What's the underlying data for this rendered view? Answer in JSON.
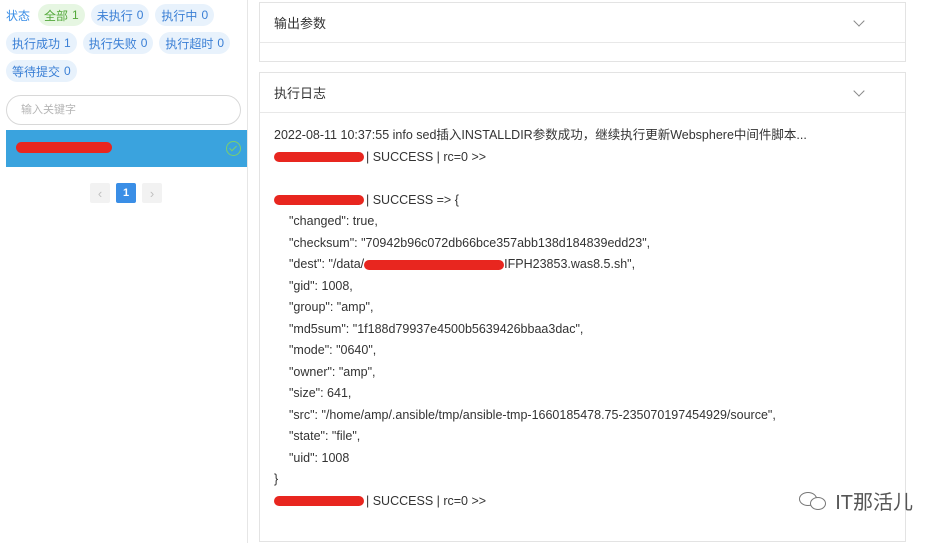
{
  "filters": {
    "status_label": "状态",
    "chips": [
      {
        "label": "全部",
        "count": "1",
        "active": true
      },
      {
        "label": "未执行",
        "count": "0"
      },
      {
        "label": "执行中",
        "count": "0"
      },
      {
        "label": "执行成功",
        "count": "1"
      },
      {
        "label": "执行失败",
        "count": "0"
      },
      {
        "label": "执行超时",
        "count": "0"
      },
      {
        "label": "等待提交",
        "count": "0"
      }
    ]
  },
  "search": {
    "placeholder": "输入关键字"
  },
  "pagination": {
    "prev": "‹",
    "current": "1",
    "next": "›"
  },
  "panels": {
    "output_params_title": "输出参数",
    "exec_log_title": "执行日志"
  },
  "log": {
    "line1": "2022-08-11 10:37:55 info sed插入INSTALLDIR参数成功，继续执行更新Websphere中间件脚本...",
    "line2_suffix": "| SUCCESS | rc=0 >>",
    "line4_suffix": "| SUCCESS => {",
    "changed": "\"changed\": true,",
    "checksum": "\"checksum\": \"70942b96c072db66bce357abb138d184839edd23\",",
    "dest_prefix": "\"dest\": \"/data/",
    "dest_suffix": "IFPH23853.was8.5.sh\",",
    "gid": "\"gid\": 1008,",
    "group": "\"group\": \"amp\",",
    "md5sum": "\"md5sum\": \"1f188d79937e4500b5639426bbaa3dac\",",
    "mode": "\"mode\": \"0640\",",
    "owner": "\"owner\": \"amp\",",
    "size": "\"size\": 641,",
    "src": "\"src\": \"/home/amp/.ansible/tmp/ansible-tmp-1660185478.75-235070197454929/source\",",
    "state": "\"state\": \"file\",",
    "uid": "\"uid\": 1008",
    "close": "}",
    "last_suffix": "| SUCCESS | rc=0 >>"
  },
  "watermark": {
    "text": "IT那活儿"
  },
  "colors": {
    "accent": "#3a8ee6",
    "selected_row": "#3aa3de",
    "success": "#7ccf6c",
    "redaction": "#e8261f"
  }
}
